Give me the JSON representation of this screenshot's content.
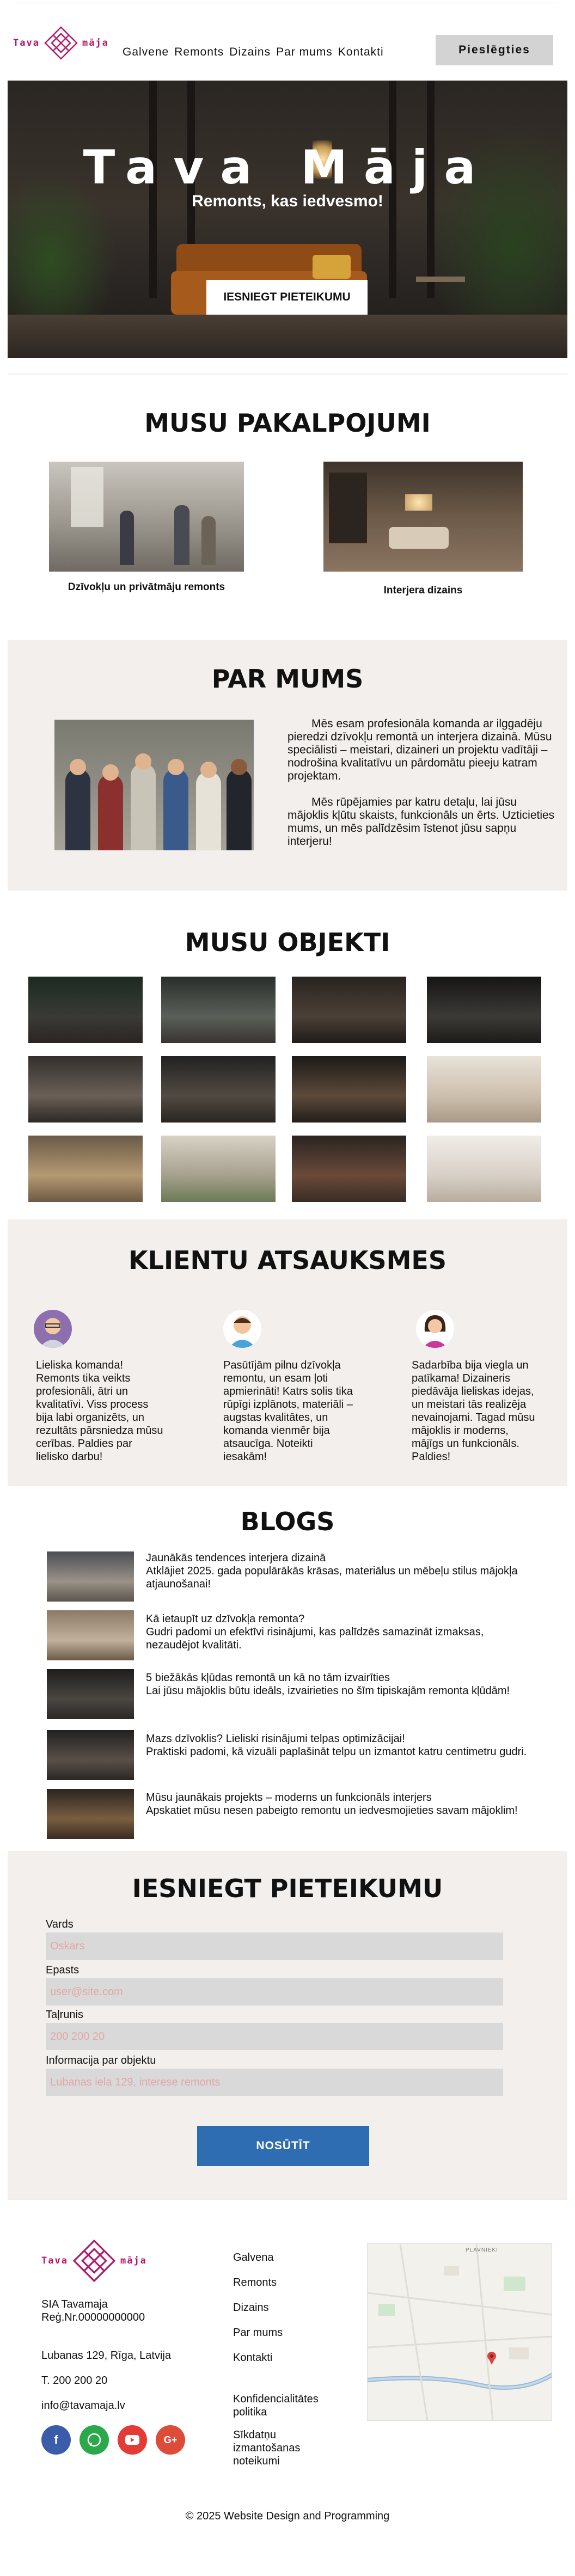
{
  "header": {
    "logo_left": "Tava",
    "logo_right": "māja",
    "nav": [
      "Galvene",
      "Remonts",
      "Dizains",
      "Par mums",
      "Kontakti"
    ],
    "login_label": "Pieslēgties"
  },
  "hero": {
    "title": "Tava Māja",
    "subtitle": "Remonts, kas iedvesmo!",
    "cta_label": "IESNIEGT PIETEIKUMU"
  },
  "services": {
    "title": "MUSU PAKALPOJUMI",
    "items": [
      {
        "caption": "Dzīvokļu un privātmāju remonts"
      },
      {
        "caption": "Interjera dizains"
      }
    ]
  },
  "about": {
    "title": "PAR MUMS",
    "paragraphs": [
      "Mēs esam profesionāla komanda ar ilggadēju pieredzi dzīvokļu remontā un interjera dizainā. Mūsu speciālisti – meistari, dizaineri un projektu vadītāji – nodrošina kvalitatīvu un pārdomātu pieeju katram projektam.",
      "Mēs rūpējamies par katru detaļu, lai jūsu mājoklis kļūtu skaists, funkcionāls un ērts. Uzticieties mums, un mēs palīdzēsim īstenot jūsu sapņu interjeru!"
    ]
  },
  "objects": {
    "title": "MUSU OBJEKTI"
  },
  "reviews": {
    "title": "KLIENTU ATSAUKSMES",
    "items": [
      {
        "text": "Lieliska komanda! Remonts tika veikts profesionāli, ātri un kvalitatīvi. Viss process bija labi organizēts, un rezultāts pārsniedza mūsu cerības. Paldies par lielisko darbu!"
      },
      {
        "text": "Pasūtījām pilnu dzīvokļa remontu, un esam ļoti apmierināti! Katrs solis tika rūpīgi izplānots, materiāli – augstas kvalitātes, un komanda vienmēr bija atsaucīga. Noteikti iesakām!"
      },
      {
        "text": "Sadarbība bija viegla un patīkama! Dizaineris piedāvāja lieliskas idejas, un meistari tās realizēja nevainojami. Tagad mūsu mājoklis ir moderns, mājīgs un funkcionāls. Paldies!"
      }
    ]
  },
  "blogs": {
    "title": "BLOGS",
    "items": [
      {
        "heading": "Jaunākās tendences interjera dizainā",
        "text": "Atklājiet 2025. gada populārākās krāsas, materiālus un mēbeļu stilus mājokļa atjaunošanai!"
      },
      {
        "heading": "Kā ietaupīt uz dzīvokļa remonta?",
        "text": "Gudri padomi un efektīvi risinājumi, kas palīdzēs samazināt izmaksas, nezaudējot kvalitāti."
      },
      {
        "heading": "5 biežākās kļūdas remontā un kā no tām izvairīties",
        "text": "Lai jūsu mājoklis būtu ideāls, izvairieties no šīm tipiskajām remonta kļūdām!"
      },
      {
        "heading": "Mazs dzīvoklis? Lieliski risinājumi telpas optimizācijai!",
        "text": "Praktiski padomi, kā vizuāli paplašināt telpu un izmantot katru centimetru gudri."
      },
      {
        "heading": "Mūsu jaunākais projekts – moderns un funkcionāls interjers",
        "text": "Apskatiet mūsu nesen pabeigto remontu un iedvesmojieties savam mājoklim!"
      }
    ]
  },
  "form": {
    "title": "IESNIEGT PIETEIKUMU",
    "fields": [
      {
        "label": "Vards",
        "placeholder": "Oskars"
      },
      {
        "label": "Epasts",
        "placeholder": "user@site.com"
      },
      {
        "label": "Taļrunis",
        "placeholder": "200 200 20"
      },
      {
        "label": "Informacija par objektu",
        "placeholder": "Lubanas iela 129, interese remonts"
      }
    ],
    "submit_label": "NOSŪTĪT"
  },
  "footer": {
    "company": "SIA Tavamaja",
    "reg": "Reģ.Nr.00000000000",
    "address": "Lubanas 129, Rīga, Latvija",
    "phone": "T. 200 200 20",
    "email": "info@tavamaja.lv",
    "links": [
      "Galvena",
      "Remonts",
      "Dizains",
      "Par mums",
      "Kontakti"
    ],
    "legal": [
      "Konfidencialitātes politika",
      "Sīkdatņu izmantošanas noteikumi"
    ],
    "social": [
      "facebook-icon",
      "whatsapp-icon",
      "youtube-icon",
      "google-plus-icon"
    ],
    "copyright": "© 2025 Website Design and Programming",
    "map_label": "PLAVNIEKI"
  },
  "colors": {
    "brand": "#b3176b",
    "section_bg": "#f2efec",
    "button_blue": "#2f6db2",
    "login_bg": "#d3d3d3"
  }
}
